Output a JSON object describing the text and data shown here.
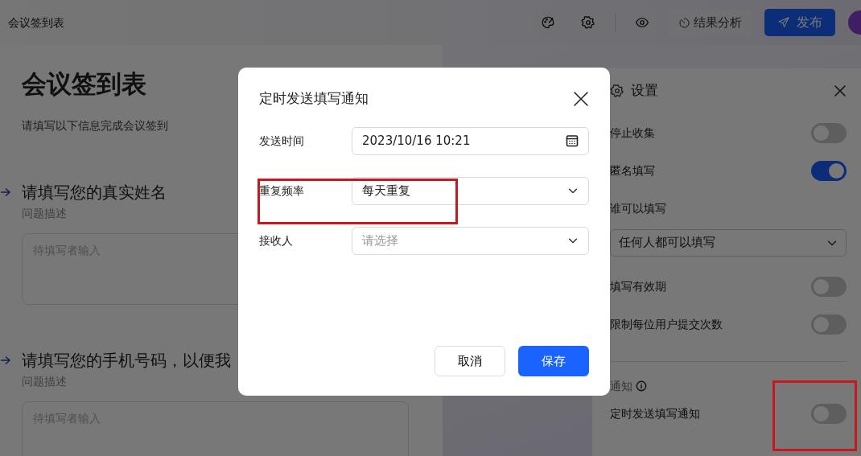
{
  "app_bar": {
    "title": "会议签到表",
    "analysis_button": "结果分析",
    "publish_button": "发布"
  },
  "form": {
    "title": "会议签到表",
    "description": "请填写以下信息完成会议签到",
    "questions": [
      {
        "title": "请填写您的真实姓名",
        "description": "问题描述",
        "placeholder": "待填写者输入"
      },
      {
        "title": "请填写您的手机号码，以便我",
        "description": "问题描述",
        "placeholder": "待填写者输入"
      }
    ]
  },
  "settings_panel": {
    "title": "设置",
    "items": [
      {
        "kind": "toggle",
        "label": "停止收集",
        "on": false
      },
      {
        "kind": "toggle",
        "label": "匿名填写",
        "on": true
      },
      {
        "kind": "label",
        "label": "谁可以填写"
      },
      {
        "kind": "select",
        "value": "任何人都可以填写"
      },
      {
        "kind": "toggle",
        "label": "填写有效期",
        "on": false
      },
      {
        "kind": "toggle",
        "label": "限制每位用户提交次数",
        "on": false
      },
      {
        "kind": "divider"
      },
      {
        "kind": "heading",
        "label": "通知"
      },
      {
        "kind": "toggle",
        "label": "定时发送填写通知",
        "on": false
      }
    ]
  },
  "dialog": {
    "title": "定时发送填写通知",
    "fields": [
      {
        "kind": "date",
        "label": "发送时间",
        "value": "2023/10/16 10:21"
      },
      {
        "kind": "select",
        "label": "重复频率",
        "value": "每天重复"
      },
      {
        "kind": "select",
        "label": "接收人",
        "placeholder": "请选择"
      }
    ],
    "buttons": [
      {
        "kind": "secondary",
        "label": "取消"
      },
      {
        "kind": "primary",
        "label": "保存"
      }
    ]
  }
}
